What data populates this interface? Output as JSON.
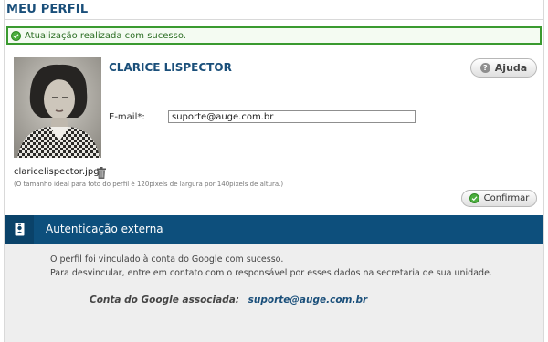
{
  "page": {
    "title": "MEU PERFIL"
  },
  "alert": {
    "message": "Atualização realizada com sucesso."
  },
  "profile": {
    "name": "CLARICE LISPECTOR",
    "help_label": "Ajuda",
    "email_label": "E-mail*:",
    "email_value": "suporte@auge.com.br",
    "photo_filename": "claricelispector.jpg",
    "photo_hint": "(O tamanho ideal para foto do perfil é 120pixels de largura por 140pixels de altura.)",
    "confirm_label": "Confirmar"
  },
  "external_auth": {
    "title": "Autenticação externa",
    "line1": "O perfil foi vinculado à conta do Google com sucesso.",
    "line2": "Para desvincular, entre em contato com o responsável por esses dados na secretaria de sua unidade.",
    "google_label": "Conta do Google associada:",
    "google_email": "suporte@auge.com.br"
  },
  "icons": {
    "alert": "check-circle-icon",
    "help": "question-circle-icon",
    "delete": "trash-icon",
    "confirm": "check-circle-icon",
    "section": "id-badge-icon"
  },
  "colors": {
    "brand_blue": "#1a4f7a",
    "header_bar": "#0d4f7c",
    "success_green": "#3a9a2f",
    "section_bg": "#eeeeee"
  }
}
